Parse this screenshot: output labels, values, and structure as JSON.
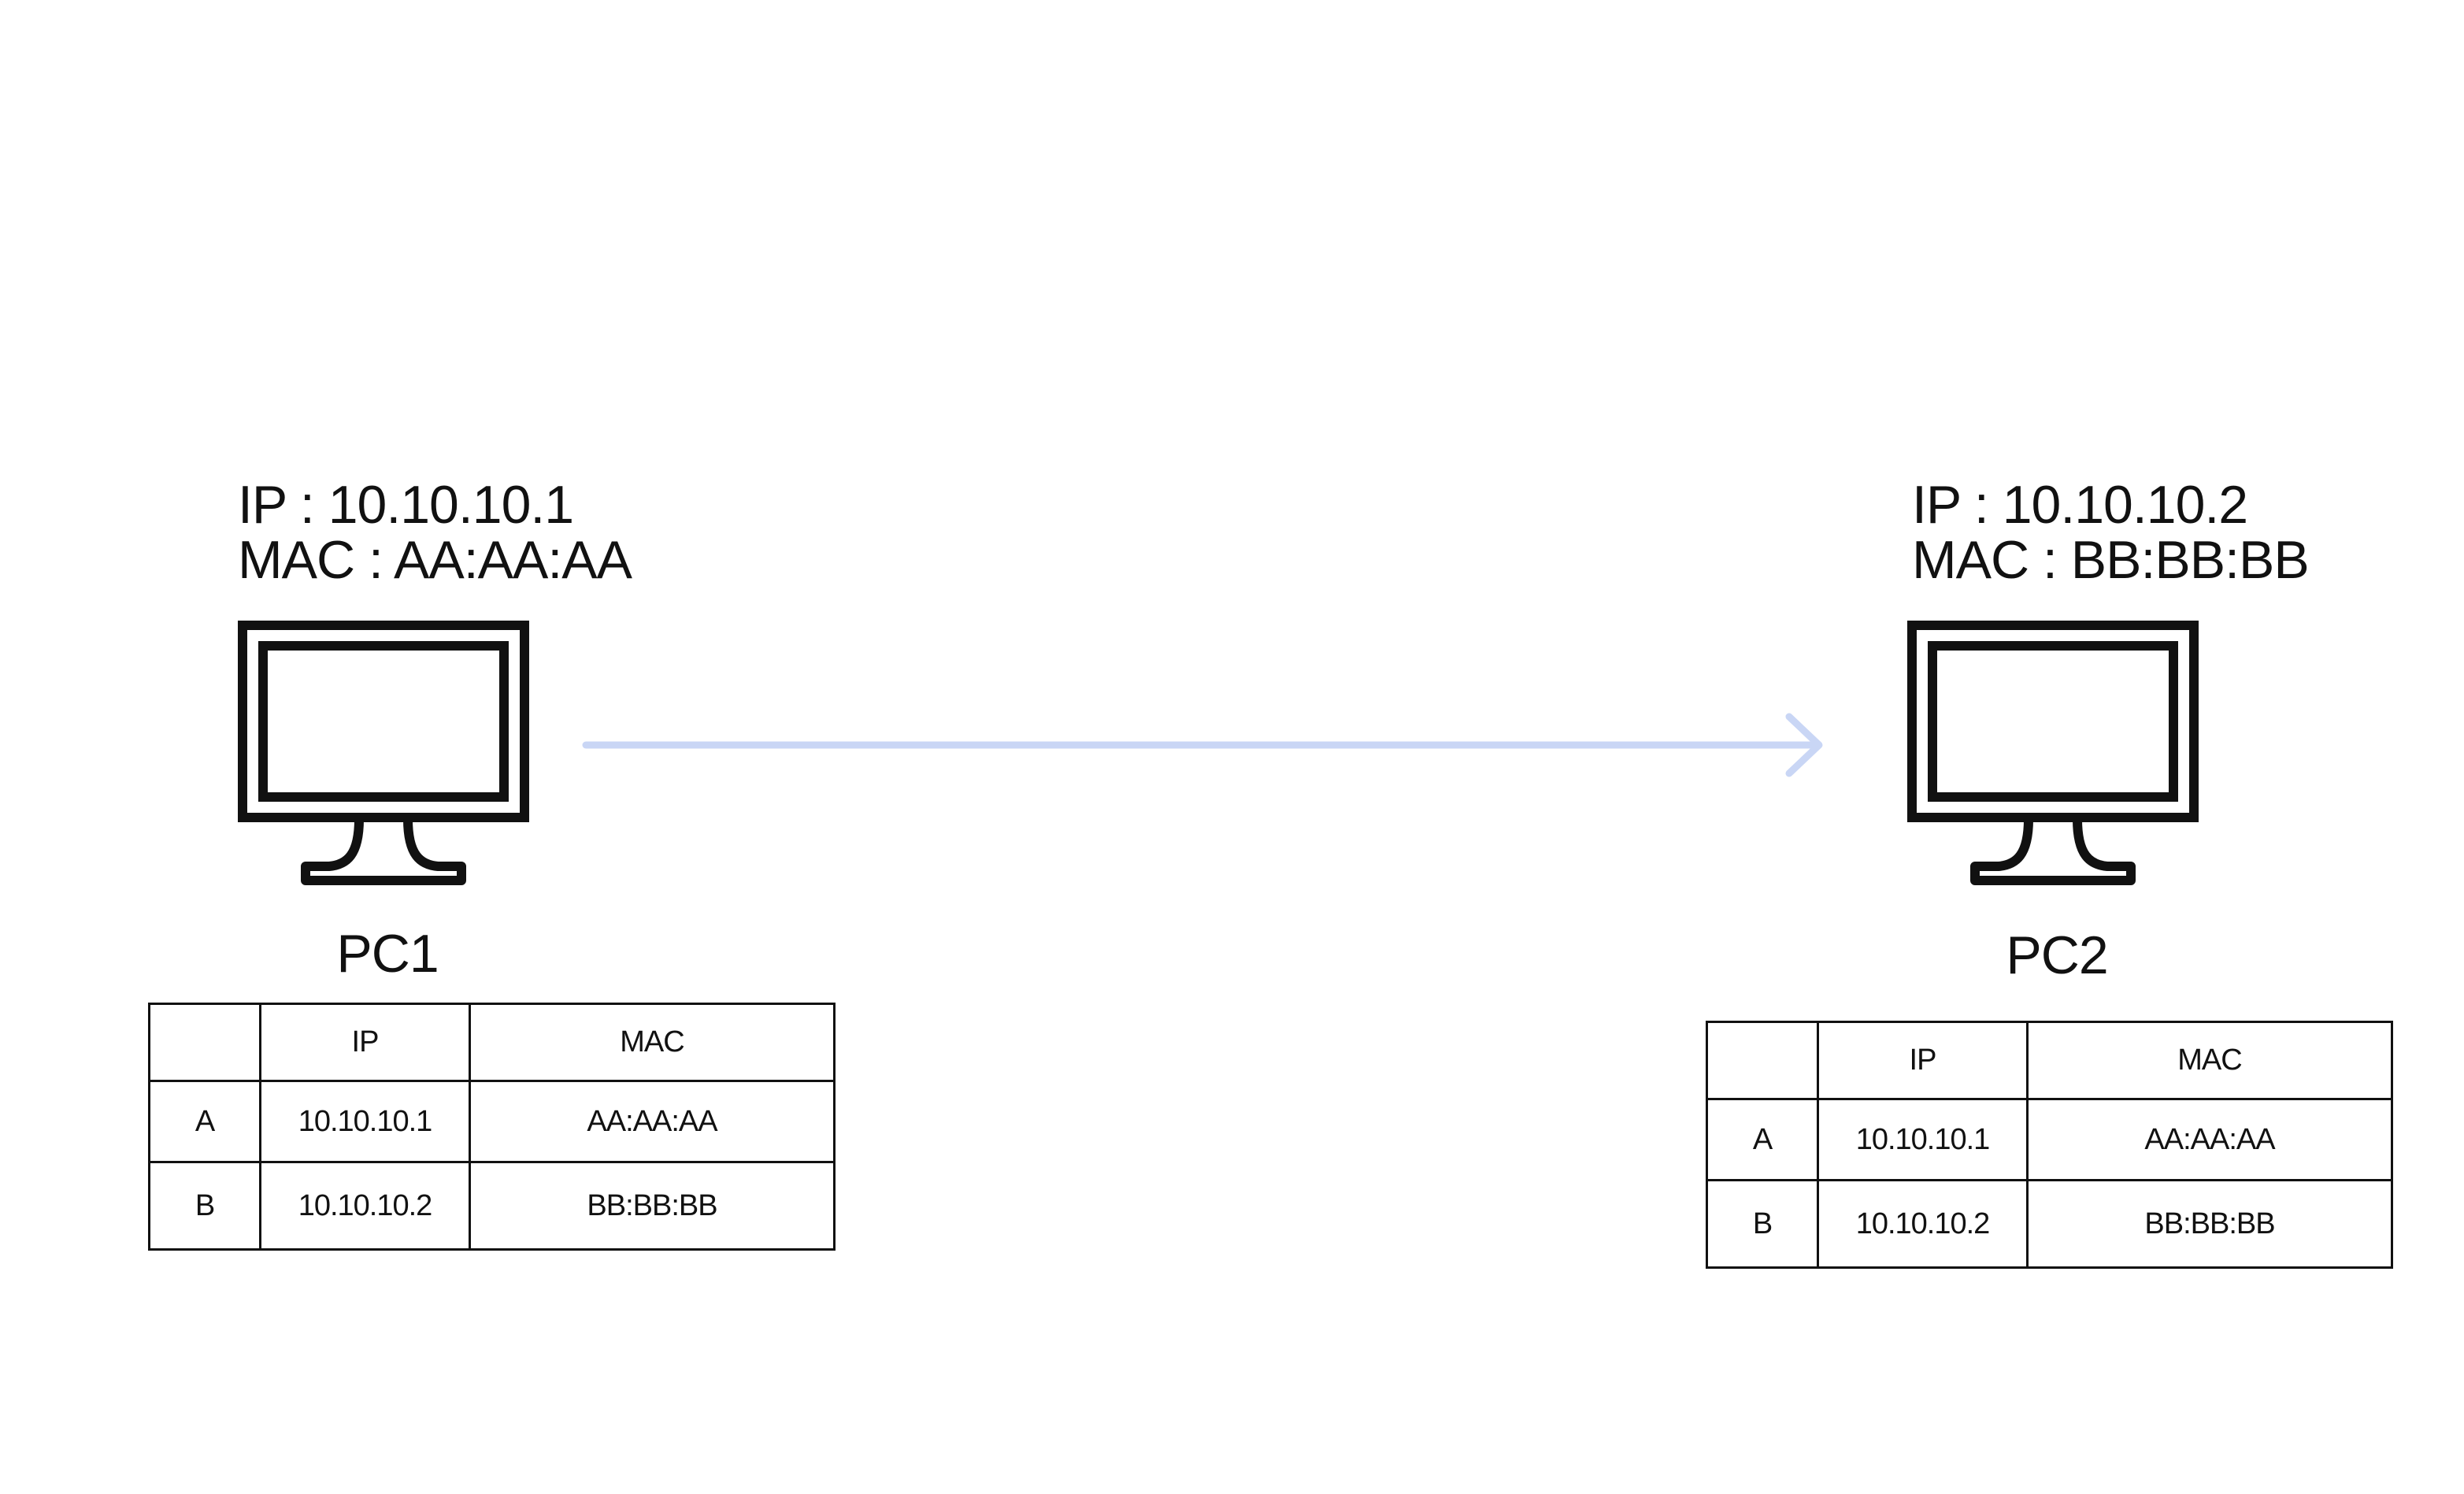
{
  "arrow_color": "#c9d6f5",
  "line_color": "#111111",
  "pc1": {
    "ip_line": "IP : 10.10.10.1",
    "mac_line": "MAC : AA:AA:AA",
    "label": "PC1",
    "table": {
      "headers": [
        "",
        "IP",
        "MAC"
      ],
      "rows": [
        {
          "name": "A",
          "ip": "10.10.10.1",
          "mac": "AA:AA:AA"
        },
        {
          "name": "B",
          "ip": "10.10.10.2",
          "mac": "BB:BB:BB"
        }
      ]
    }
  },
  "pc2": {
    "ip_line": "IP : 10.10.10.2",
    "mac_line": "MAC : BB:BB:BB",
    "label": "PC2",
    "table": {
      "headers": [
        "",
        "IP",
        "MAC"
      ],
      "rows": [
        {
          "name": "A",
          "ip": "10.10.10.1",
          "mac": "AA:AA:AA"
        },
        {
          "name": "B",
          "ip": "10.10.10.2",
          "mac": "BB:BB:BB"
        }
      ]
    }
  }
}
